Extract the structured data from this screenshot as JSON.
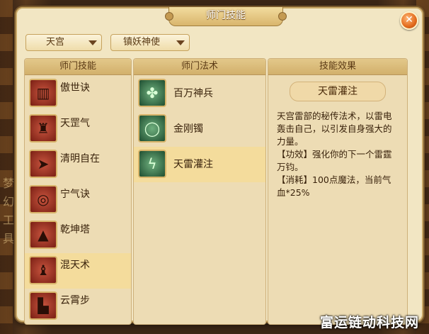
{
  "window": {
    "title": "师门技能",
    "close_label": "✕"
  },
  "filters": {
    "school_selected": "天宫",
    "role_selected": "镇妖神使"
  },
  "skills_panel": {
    "header": "师门技能",
    "items": [
      {
        "label": "傲世诀",
        "icon": "scroll-icon"
      },
      {
        "label": "天罡气",
        "icon": "warrior-icon"
      },
      {
        "label": "清明自在",
        "icon": "arrow-icon"
      },
      {
        "label": "宁气诀",
        "icon": "mirror-icon"
      },
      {
        "label": "乾坤塔",
        "icon": "pagoda-icon"
      },
      {
        "label": "混天术",
        "icon": "lantern-icon"
      },
      {
        "label": "云霄步",
        "icon": "boot-icon"
      }
    ],
    "selected_index": 5
  },
  "spells_panel": {
    "header": "师门法术",
    "items": [
      {
        "label": "百万神兵",
        "icon": "soldiers-icon"
      },
      {
        "label": "金刚镯",
        "icon": "bracelet-icon"
      },
      {
        "label": "天雷灌注",
        "icon": "thunder-icon"
      }
    ],
    "selected_index": 2
  },
  "effect_panel": {
    "header": "技能效果",
    "title": "天雷灌注",
    "description": "天宫雷部的秘传法术，以雷电轰击自己，以引发自身强大的力量。",
    "effect": "【功效】强化你的下一个雷霆万钧。",
    "cost": "【消耗】100点魔法，当前气血*25%"
  },
  "side_text": "梦幻工具",
  "watermark": "富运链动科技网",
  "colors": {
    "panel_bg": "#eddcb4",
    "header_bg": "#d2b06b",
    "selected_bg": "#f4dc9c",
    "close_orange": "#e26a1c"
  }
}
